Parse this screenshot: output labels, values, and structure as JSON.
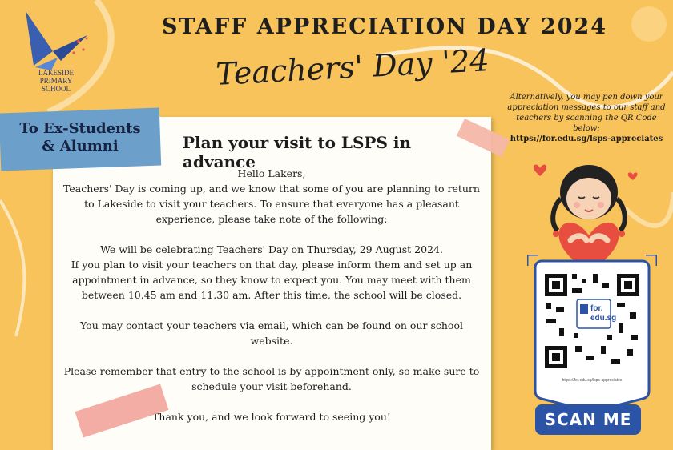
{
  "header": {
    "title": "STAFF APPRECIATION DAY 2024",
    "subtitle": "Teachers' Day '24"
  },
  "logo": {
    "line1": "LAKESIDE",
    "line2": "PRIMARY",
    "line3": "SCHOOL"
  },
  "audience_tag": {
    "line1": "To Ex-Students",
    "line2": "& Alumni"
  },
  "notice": {
    "heading": "Plan your visit to LSPS in advance",
    "greeting": "Hello Lakers,",
    "intro": "Teachers' Day is coming up, and we know that some of you are planning to return to Lakeside to visit your teachers. To ensure that everyone has a pleasant experience, please take note of the following:",
    "date_line": "We will be celebrating Teachers' Day on Thursday, 29 August 2024.",
    "appointment": "If you plan to visit your teachers on that day, please inform them and set up an appointment in advance, so they know to expect you. You may meet with them between 10.45 am and 11.30 am. After this time, the school will be closed.",
    "contact": "You may contact your teachers via email, which can be found on our school website.",
    "entry": "Please remember that entry to the school is by appointment only, so make sure to schedule your visit beforehand.",
    "closing": "Thank you, and we look forward to seeing you!"
  },
  "side_panel": {
    "text": "Alternatively, you may pen down your appreciation messages to our staff and teachers by scanning the QR Code below:",
    "url": "https://for.edu.sg/lsps-appreciates"
  },
  "qr": {
    "badge_top": "for.",
    "badge_bottom": "edu.sg",
    "caption": "https://for.edu.sg/lsps-appreciates",
    "button_label": "SCAN ME"
  },
  "colors": {
    "background": "#f7c35a",
    "tape_blue": "#6c9fc9",
    "tape_pink": "#f2a9a0",
    "button_blue": "#2b54a6"
  }
}
